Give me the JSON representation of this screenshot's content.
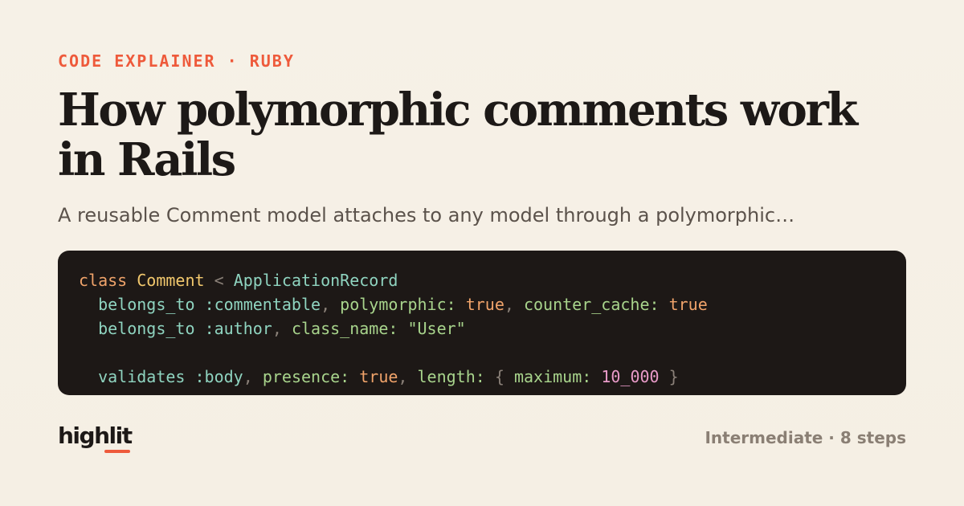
{
  "eyebrow": "CODE EXPLAINER · RUBY",
  "title": "How polymorphic comments work in Rails",
  "subtitle": "A reusable Comment model attaches to any model through a polymorphic…",
  "code": {
    "line1": {
      "keyword": "class",
      "class_name": "Comment",
      "operator": "<",
      "parent": "ApplicationRecord"
    },
    "line2": {
      "method": "belongs_to",
      "symbol": ":commentable",
      "sep1": ",",
      "key1": "polymorphic:",
      "val1": "true",
      "sep2": ",",
      "key2": "counter_cache:",
      "val2": "true"
    },
    "line3": {
      "method": "belongs_to",
      "symbol": ":author",
      "sep1": ",",
      "key1": "class_name:",
      "val1": "\"User\""
    },
    "line5": {
      "method": "validates",
      "symbol": ":body",
      "sep1": ",",
      "key1": "presence:",
      "val1": "true",
      "sep2": ",",
      "key2": "length:",
      "brace_open": "{",
      "key3": "maximum:",
      "val3": "10_000",
      "brace_close": "}"
    }
  },
  "logo": {
    "text": "highlit"
  },
  "meta": "Intermediate · 8 steps",
  "colors": {
    "background": "#f6f1e7",
    "accent": "#ee5a3b",
    "code_background": "#1d1816",
    "title": "#1d1917"
  }
}
